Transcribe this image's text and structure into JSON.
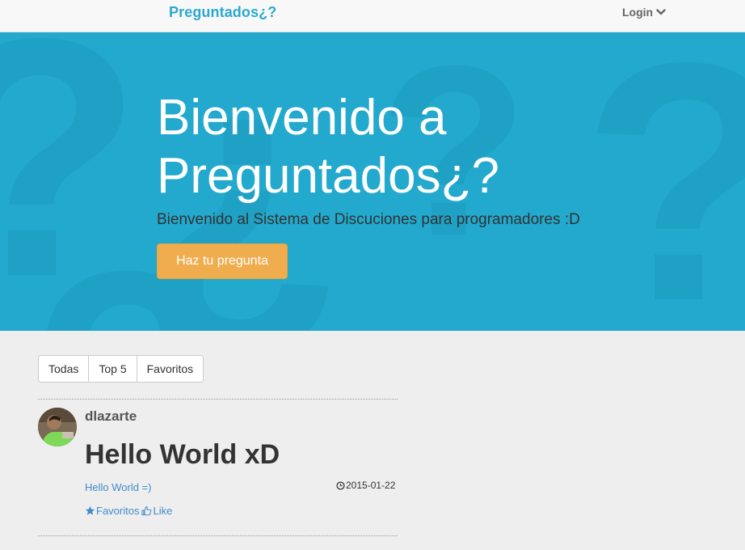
{
  "navbar": {
    "brand": "Preguntados¿?",
    "login_label": "Login"
  },
  "hero": {
    "title": "Bienvenido a Preguntados¿?",
    "subtitle": "Bienvenido al Sistema de Discuciones para programadores :D",
    "cta_label": "Haz tu pregunta",
    "bg_color": "#22a9cd",
    "cta_color": "#f0ad4e"
  },
  "filters": {
    "tabs": [
      "Todas",
      "Top 5",
      "Favoritos"
    ]
  },
  "questions": [
    {
      "user": "dlazarte",
      "title": "Hello World xD",
      "body": "Hello World =)",
      "date": "2015-01-22",
      "favorite_label": "Favoritos",
      "like_label": "Like"
    }
  ],
  "colors": {
    "brand": "#2ba9cf",
    "link": "#428bca"
  }
}
